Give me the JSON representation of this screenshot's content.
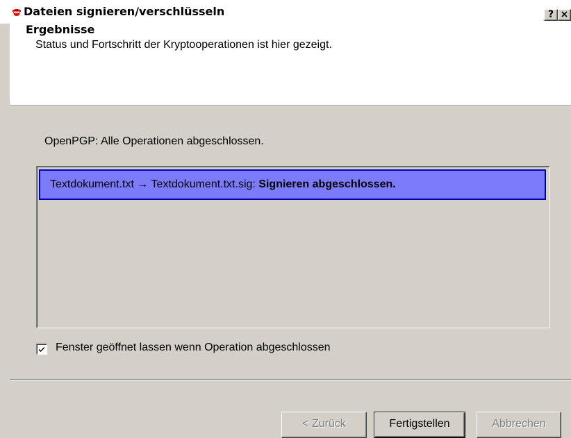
{
  "window": {
    "title": "Dateien signieren/verschlüsseln",
    "help_button": "?",
    "close_button": "×"
  },
  "header": {
    "title": "Ergebnisse",
    "subtitle": "Status und Fortschritt der Kryptooperationen ist hier gezeigt."
  },
  "status": {
    "text": "OpenPGP: Alle Operationen abgeschlossen."
  },
  "results": {
    "items": [
      {
        "operation": "Textdokument.txt → Textdokument.txt.sig:",
        "status": "Signieren abgeschlossen."
      }
    ]
  },
  "options": {
    "keep_open_label": "Fenster geöffnet lassen wenn Operation abgeschlossen",
    "keep_open_checked": true
  },
  "buttons": {
    "back": "< Zurück",
    "finish": "Fertigstellen",
    "cancel": "Abbrechen"
  },
  "colors": {
    "dialog_bg": "#d4d0c8",
    "selection_bg": "#7b7bfb",
    "selection_border": "#0000b0"
  }
}
